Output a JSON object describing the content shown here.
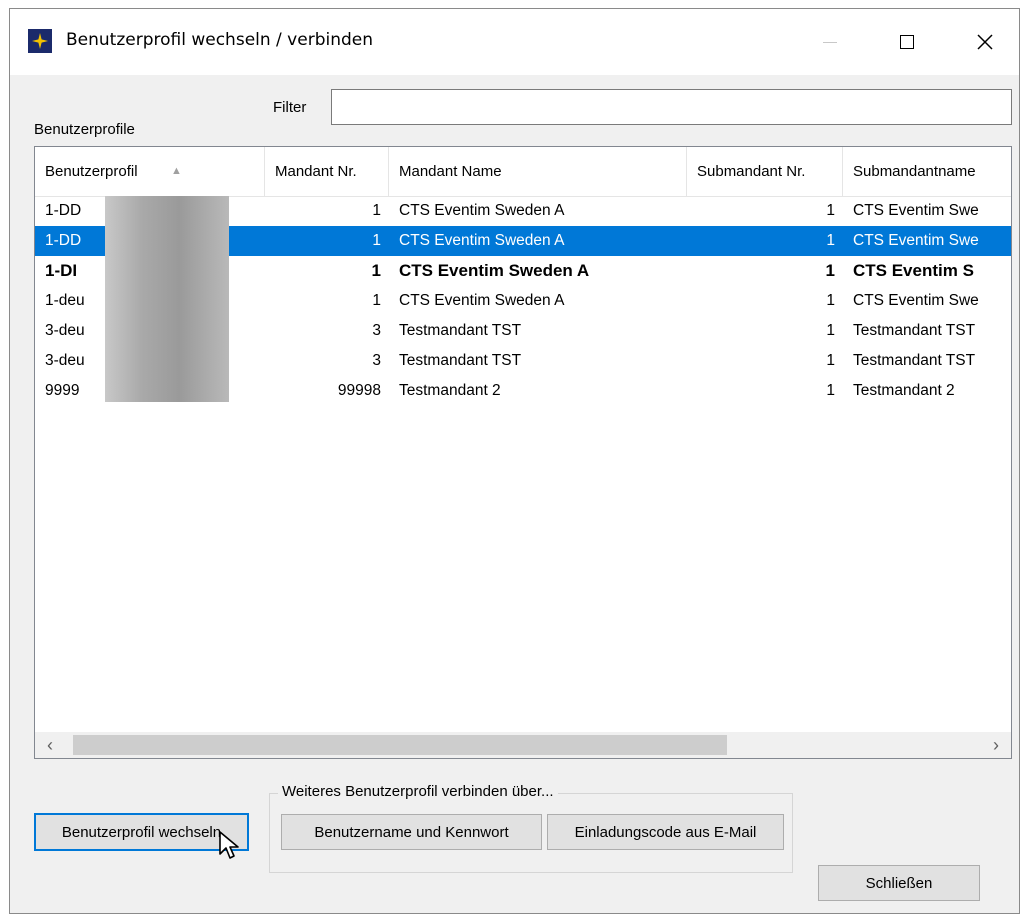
{
  "window": {
    "title": "Benutzerprofil wechseln / verbinden"
  },
  "filter": {
    "label": "Filter",
    "value": ""
  },
  "list": {
    "label": "Benutzerprofile",
    "columns": [
      "Benutzerprofil",
      "Mandant Nr.",
      "Mandant Name",
      "Submandant Nr.",
      "Submandantname"
    ],
    "rows": [
      {
        "profile": "1-DD",
        "mandant_nr": "1",
        "mandant_name": "CTS Eventim Sweden A",
        "sub_nr": "1",
        "sub_name": "CTS Eventim Swe"
      },
      {
        "profile": "1-DD",
        "mandant_nr": "1",
        "mandant_name": "CTS Eventim Sweden A",
        "sub_nr": "1",
        "sub_name": "CTS Eventim Swe"
      },
      {
        "profile": "1-DI",
        "mandant_nr": "1",
        "mandant_name": "CTS Eventim Sweden A",
        "sub_nr": "1",
        "sub_name": "CTS Eventim S"
      },
      {
        "profile": "1-deu",
        "mandant_nr": "1",
        "mandant_name": "CTS Eventim Sweden A",
        "sub_nr": "1",
        "sub_name": "CTS Eventim Swe"
      },
      {
        "profile": "3-deu",
        "mandant_nr": "3",
        "mandant_name": "Testmandant TST",
        "sub_nr": "1",
        "sub_name": "Testmandant TST"
      },
      {
        "profile": "3-deu",
        "mandant_nr": "3",
        "mandant_name": "Testmandant TST",
        "sub_nr": "1",
        "sub_name": "Testmandant TST"
      },
      {
        "profile": "9999",
        "mandant_nr": "99998",
        "mandant_name": "Testmandant 2",
        "sub_nr": "1",
        "sub_name": "Testmandant 2"
      }
    ]
  },
  "group": {
    "caption": "Weiteres Benutzerprofil verbinden über..."
  },
  "buttons": {
    "switch": "Benutzerprofil wechseln",
    "credentials": "Benutzername und Kennwort",
    "invite": "Einladungscode aus E-Mail",
    "close": "Schließen"
  },
  "colors": {
    "selection": "#0078d7",
    "app_icon": "#1b2a6b",
    "app_icon_star": "#f2c200"
  }
}
